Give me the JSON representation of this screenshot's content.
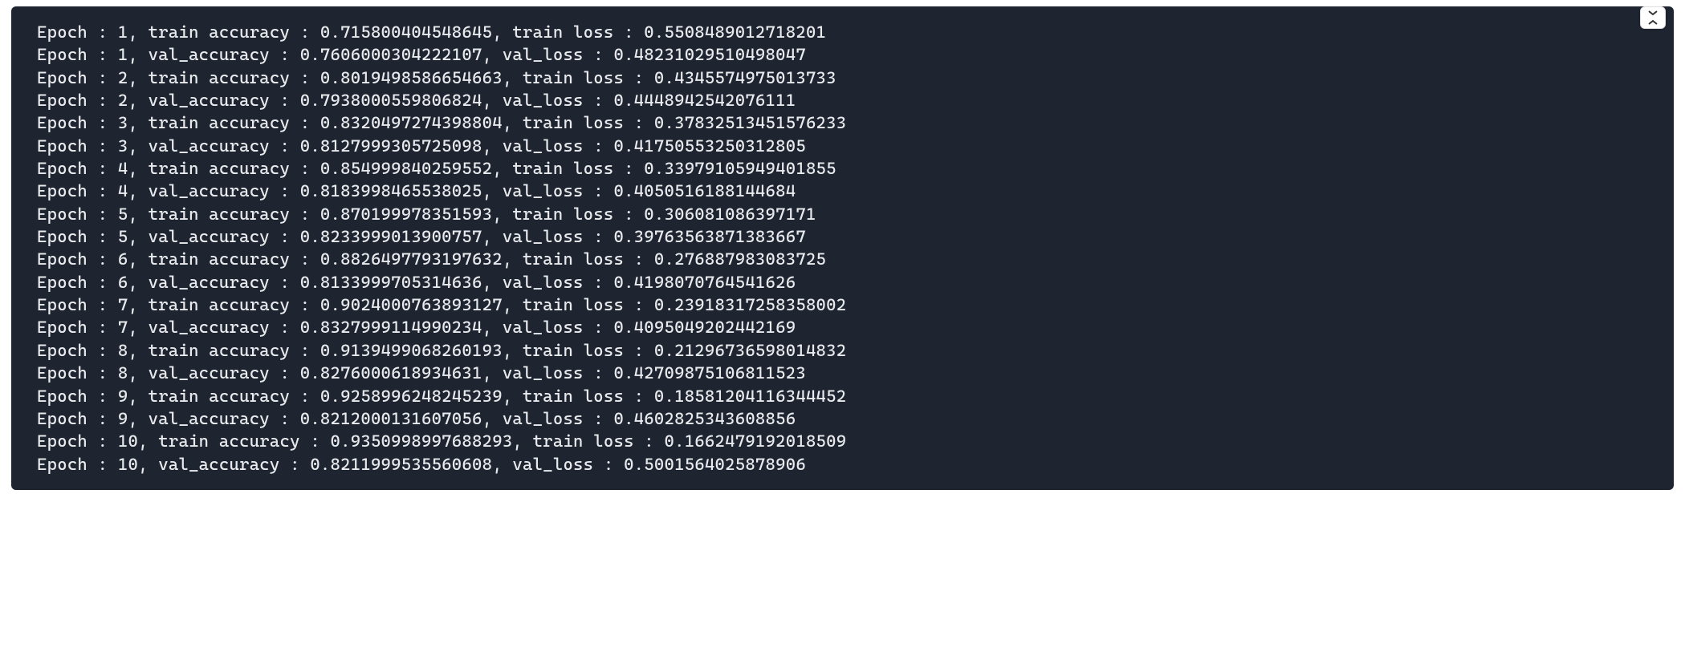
{
  "output": {
    "lines": [
      "Epoch : 1, train accuracy : 0.715800404548645, train loss : 0.5508489012718201",
      "Epoch : 1, val_accuracy : 0.7606000304222107, val_loss : 0.48231029510498047",
      "Epoch : 2, train accuracy : 0.8019498586654663, train loss : 0.4345574975013733",
      "Epoch : 2, val_accuracy : 0.7938000559806824, val_loss : 0.4448942542076111",
      "Epoch : 3, train accuracy : 0.8320497274398804, train loss : 0.37832513451576233",
      "Epoch : 3, val_accuracy : 0.8127999305725098, val_loss : 0.41750553250312805",
      "Epoch : 4, train accuracy : 0.854999840259552, train loss : 0.33979105949401855",
      "Epoch : 4, val_accuracy : 0.8183998465538025, val_loss : 0.4050516188144684",
      "Epoch : 5, train accuracy : 0.870199978351593, train loss : 0.306081086397171",
      "Epoch : 5, val_accuracy : 0.8233999013900757, val_loss : 0.39763563871383667",
      "Epoch : 6, train accuracy : 0.8826497793197632, train loss : 0.276887983083725",
      "Epoch : 6, val_accuracy : 0.8133999705314636, val_loss : 0.4198070764541626",
      "Epoch : 7, train accuracy : 0.9024000763893127, train loss : 0.23918317258358002",
      "Epoch : 7, val_accuracy : 0.8327999114990234, val_loss : 0.4095049202442169",
      "Epoch : 8, train accuracy : 0.9139499068260193, train loss : 0.21296736598014832",
      "Epoch : 8, val_accuracy : 0.8276000618934631, val_loss : 0.42709875106811523",
      "Epoch : 9, train accuracy : 0.9258996248245239, train loss : 0.18581204116344452",
      "Epoch : 9, val_accuracy : 0.8212000131607056, val_loss : 0.4602825343608856",
      "Epoch : 10, train accuracy : 0.9350998997688293, train loss : 0.1662479192018509",
      "Epoch : 10, val_accuracy : 0.8211999535560608, val_loss : 0.5001564025878906"
    ]
  }
}
